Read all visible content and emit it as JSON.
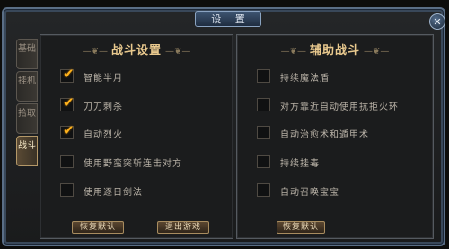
{
  "window": {
    "title": "设 置",
    "close_glyph": "✕"
  },
  "tabs": [
    {
      "label": "基础",
      "active": false
    },
    {
      "label": "挂机",
      "active": false
    },
    {
      "label": "拾取",
      "active": false
    },
    {
      "label": "战斗",
      "active": true
    }
  ],
  "left_panel": {
    "title": "战斗设置",
    "options": [
      {
        "label": "智能半月",
        "checked": true
      },
      {
        "label": "刀刀刺杀",
        "checked": true
      },
      {
        "label": "自动烈火",
        "checked": true
      },
      {
        "label": "使用野蛮突斩连击对方",
        "checked": false
      },
      {
        "label": "使用逐日剑法",
        "checked": false
      }
    ],
    "buttons": {
      "reset": "恢复默认",
      "quick": "退出游戏"
    }
  },
  "right_panel": {
    "title": "辅助战斗",
    "options": [
      {
        "label": "持续魔法盾",
        "checked": false
      },
      {
        "label": "对方靠近自动使用抗拒火环",
        "checked": false
      },
      {
        "label": "自动治愈术和遁甲术",
        "checked": false
      },
      {
        "label": "持续挂毒",
        "checked": false
      },
      {
        "label": "自动召唤宝宝",
        "checked": false
      }
    ],
    "buttons": {
      "restore": "恢复默认"
    }
  },
  "flourish": "—❦—",
  "checkmark": "✔"
}
